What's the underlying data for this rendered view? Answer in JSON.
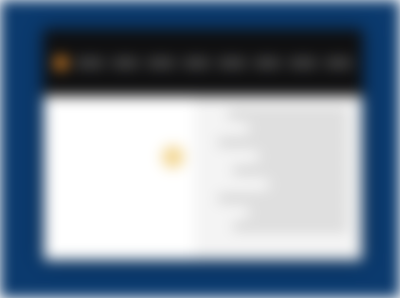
{
  "desktop": {
    "background_color": "#0b3a6e"
  },
  "window": {
    "toolbar_color": "#0f0f10",
    "content_color": "#f4f4f4",
    "accent_color": "#e0892a",
    "highlight_color": "#f2d58f"
  },
  "icons": {
    "logo": "app-logo-icon"
  }
}
